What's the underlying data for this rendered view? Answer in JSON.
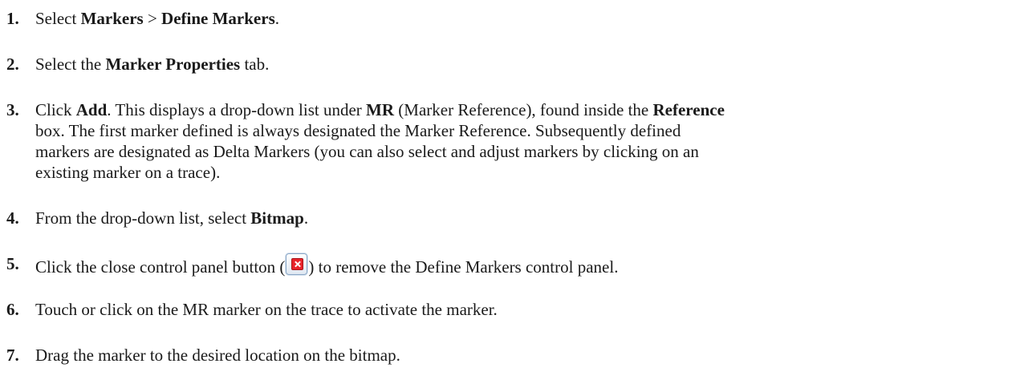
{
  "steps": [
    {
      "number": "1.",
      "parts": [
        "Select ",
        "Markers",
        " > ",
        "Define Markers",
        "."
      ]
    },
    {
      "number": "2.",
      "parts": [
        "Select the ",
        "Marker Properties",
        " tab."
      ]
    },
    {
      "number": "3.",
      "lines": [
        [
          "Click ",
          "Add",
          ". This displays a drop-down list under ",
          "MR",
          " (Marker Reference), found inside the ",
          "Reference"
        ],
        [
          "box. The first marker defined is always designated the Marker Reference.  Subsequently defined"
        ],
        [
          "markers are designated as Delta Markers (you can also select and adjust markers by clicking on an"
        ],
        [
          "existing marker on a trace)."
        ]
      ]
    },
    {
      "number": "4.",
      "parts": [
        "From the drop-down list, select ",
        "Bitmap",
        "."
      ]
    },
    {
      "number": "5.",
      "before": "Click the close control panel button (",
      "icon": "close-panel-icon",
      "after": ") to remove the Define Markers control panel."
    },
    {
      "number": "6.",
      "text": "Touch or click on the MR marker on the trace to activate the marker."
    },
    {
      "number": "7.",
      "text": "Drag the marker to the desired location on the bitmap."
    }
  ],
  "colors": {
    "text": "#1a1a1a",
    "close_icon": "#e8232a"
  }
}
